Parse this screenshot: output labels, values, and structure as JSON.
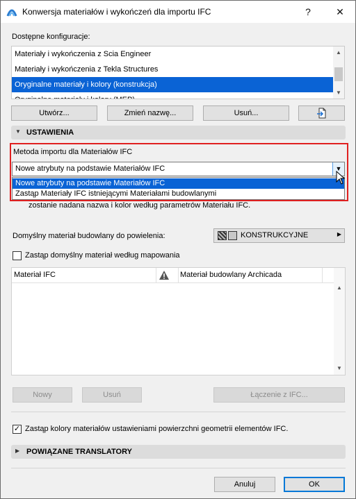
{
  "window": {
    "title": "Konwersja materiałów i wykończeń dla importu IFC",
    "help_label": "?",
    "close_label": "✕"
  },
  "configs": {
    "label": "Dostępne konfiguracje:",
    "items": [
      "Materiały i wykończenia z Scia Engineer",
      "Materiały i wykończenia z Tekla Structures",
      "Oryginalne materiały i kolory (konstrukcja)",
      "Oryginalne materiały i kolory (MEP)"
    ],
    "selected_index": 2
  },
  "config_buttons": {
    "create": "Utwórz...",
    "rename": "Zmień nazwę...",
    "delete": "Usuń..."
  },
  "settings": {
    "header": "USTAWIENIA",
    "import_method_label": "Metoda importu dla Materiałów IFC",
    "import_method_value": "Nowe atrybuty na podstawie Materiałów IFC",
    "dropdown_options": [
      "Nowe atrybuty na podstawie Materiałów IFC",
      "Zastąp Materiały IFC istniejącymi Materiałami budowlanymi"
    ],
    "hidden_note": "zostanie nadana nazwa i kolor według parametrów Materiału IFC.",
    "default_material_label": "Domyślny materiał budowlany do powielenia:",
    "default_material_value": "KONSTRUKCYJNE",
    "replace_default_label": "Zastąp domyślny materiał według mapowania",
    "replace_default_checked": false
  },
  "mapping_table": {
    "col_ifc": "Materiał IFC",
    "col_archicad": "Materiał budowlany Archicada"
  },
  "mapping_buttons": {
    "new": "Nowy",
    "delete": "Usuń",
    "merge": "Łączenie z IFC..."
  },
  "override_colors": {
    "label": "Zastąp kolory materiałów ustawieniami powierzchni geometrii elementów IFC.",
    "checked": true
  },
  "related": {
    "header": "POWIĄZANE TRANSLATORY"
  },
  "footer": {
    "cancel": "Anuluj",
    "ok": "OK"
  },
  "colors": {
    "selection": "#0a63d5",
    "highlight_box": "#e02020"
  }
}
